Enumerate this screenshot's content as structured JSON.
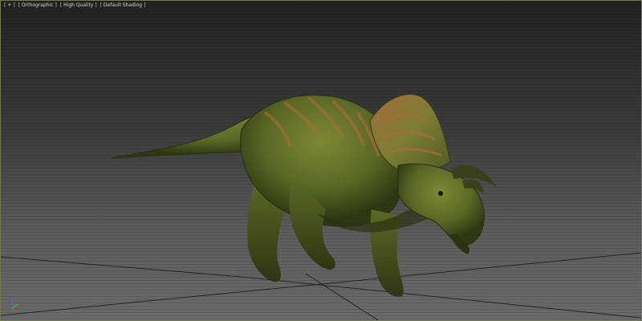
{
  "viewport": {
    "labels": {
      "view_menu": "+",
      "projection": "Orthographic",
      "quality": "High Quality",
      "shading": "Default Shading"
    },
    "frame_color": "#6f7a52",
    "background_top": "#222222",
    "background_bottom": "#6a6a6a"
  },
  "scene": {
    "subject": "ceratopsian-dinosaur-model",
    "skin_base_color": "#5e6a28",
    "stripe_color": "#b06a3b"
  },
  "axis_gizmo": {
    "icon": "axis-tripod-icon"
  }
}
